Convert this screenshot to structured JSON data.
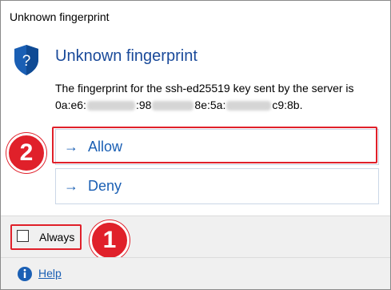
{
  "window": {
    "title": "Unknown fingerprint"
  },
  "header": {
    "heading": "Unknown fingerprint",
    "icon": "shield-question-icon"
  },
  "message": {
    "line1": "The fingerprint for the ssh-ed25519 key sent by the server is",
    "fp_part1": "0a:e6:",
    "fp_part2": ":98",
    "fp_part3": "8e:5a:",
    "fp_part4": "c9:8b."
  },
  "commands": {
    "allow": {
      "arrow": "→",
      "label": "Allow"
    },
    "deny": {
      "arrow": "→",
      "label": "Deny"
    }
  },
  "footer": {
    "checkbox_label": "Always",
    "checked": false
  },
  "help": {
    "label": "Help",
    "icon": "info-icon"
  },
  "annotations": {
    "badge_allow": "2",
    "badge_always": "1"
  },
  "colors": {
    "accent": "#1a5fb4",
    "heading": "#1a4a9a",
    "highlight": "#e0202a",
    "footer_bg": "#f0f0f0"
  }
}
